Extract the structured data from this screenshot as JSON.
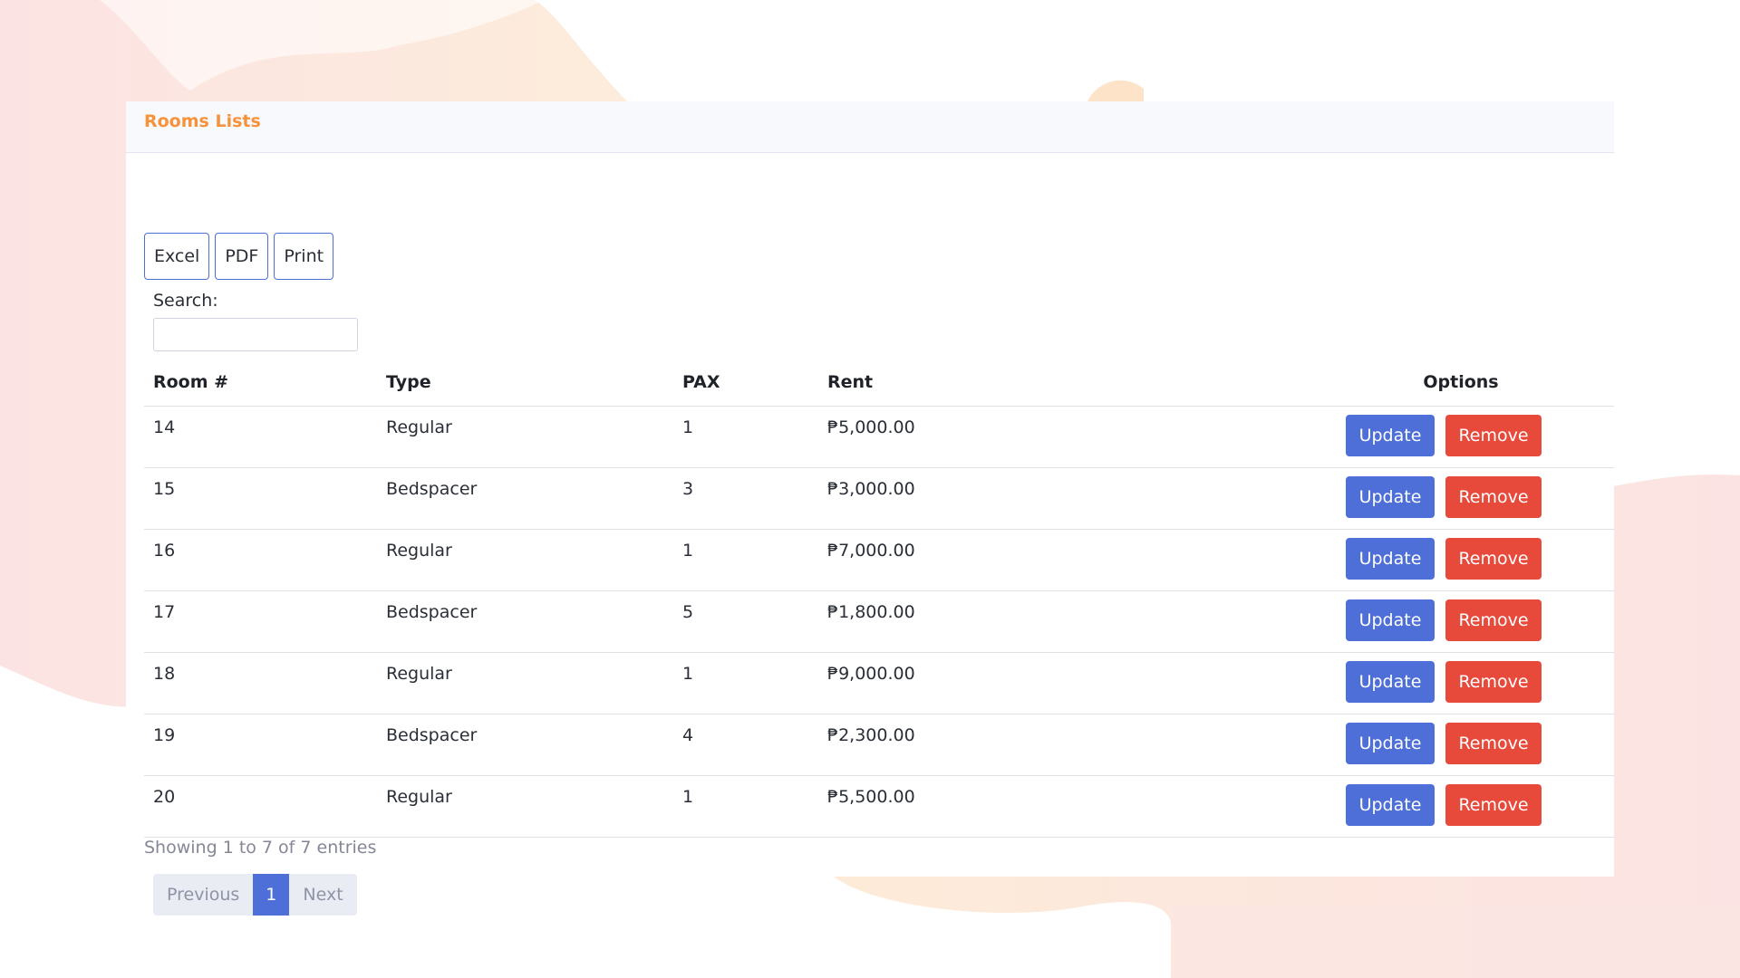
{
  "card": {
    "title": "Rooms Lists"
  },
  "export_buttons": [
    "Excel",
    "PDF",
    "Print"
  ],
  "search": {
    "label": "Search:",
    "value": "",
    "placeholder": ""
  },
  "table": {
    "columns": [
      "Room #",
      "Type",
      "PAX",
      "Rent",
      "Options"
    ],
    "rows": [
      {
        "room": "14",
        "type": "Regular",
        "pax": "1",
        "rent": "₱5,000.00"
      },
      {
        "room": "15",
        "type": "Bedspacer",
        "pax": "3",
        "rent": "₱3,000.00"
      },
      {
        "room": "16",
        "type": "Regular",
        "pax": "1",
        "rent": "₱7,000.00"
      },
      {
        "room": "17",
        "type": "Bedspacer",
        "pax": "5",
        "rent": "₱1,800.00"
      },
      {
        "room": "18",
        "type": "Regular",
        "pax": "1",
        "rent": "₱9,000.00"
      },
      {
        "room": "19",
        "type": "Bedspacer",
        "pax": "4",
        "rent": "₱2,300.00"
      },
      {
        "room": "20",
        "type": "Regular",
        "pax": "1",
        "rent": "₱5,500.00"
      }
    ],
    "update_label": "Update",
    "remove_label": "Remove"
  },
  "footer": {
    "entries_info": "Showing 1 to 7 of 7 entries",
    "previous_label": "Previous",
    "current_page": "1",
    "next_label": "Next"
  },
  "colors": {
    "accent": "#4e6fd8",
    "danger": "#e74a3b",
    "title": "#f6923a",
    "background_shapes": [
      "#fbe3e0",
      "#fde9d8"
    ]
  }
}
